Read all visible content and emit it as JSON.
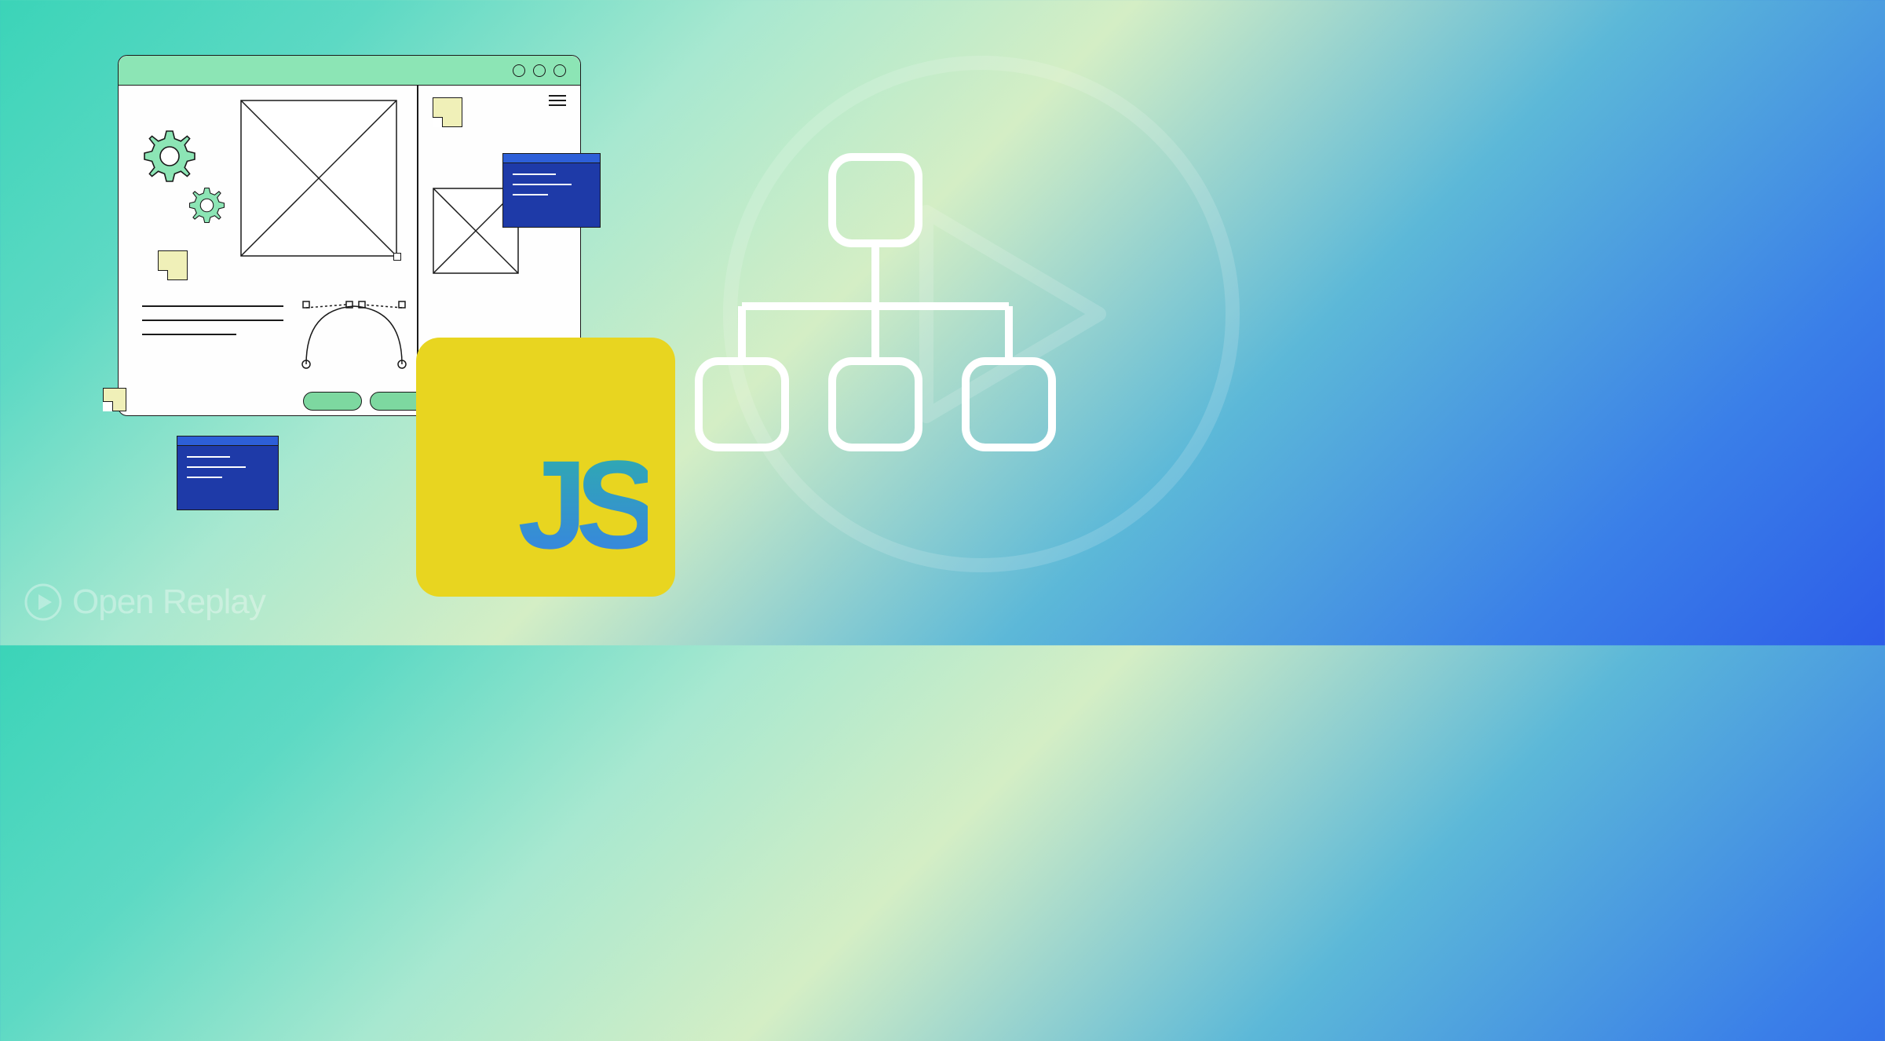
{
  "logo_text": "Open Replay",
  "js_label": "JS",
  "colors": {
    "js_bg": "#e8d520",
    "code_bg": "#1e3aa8",
    "accent_green": "#8ce5b5",
    "sticky": "#f0f0b8"
  }
}
